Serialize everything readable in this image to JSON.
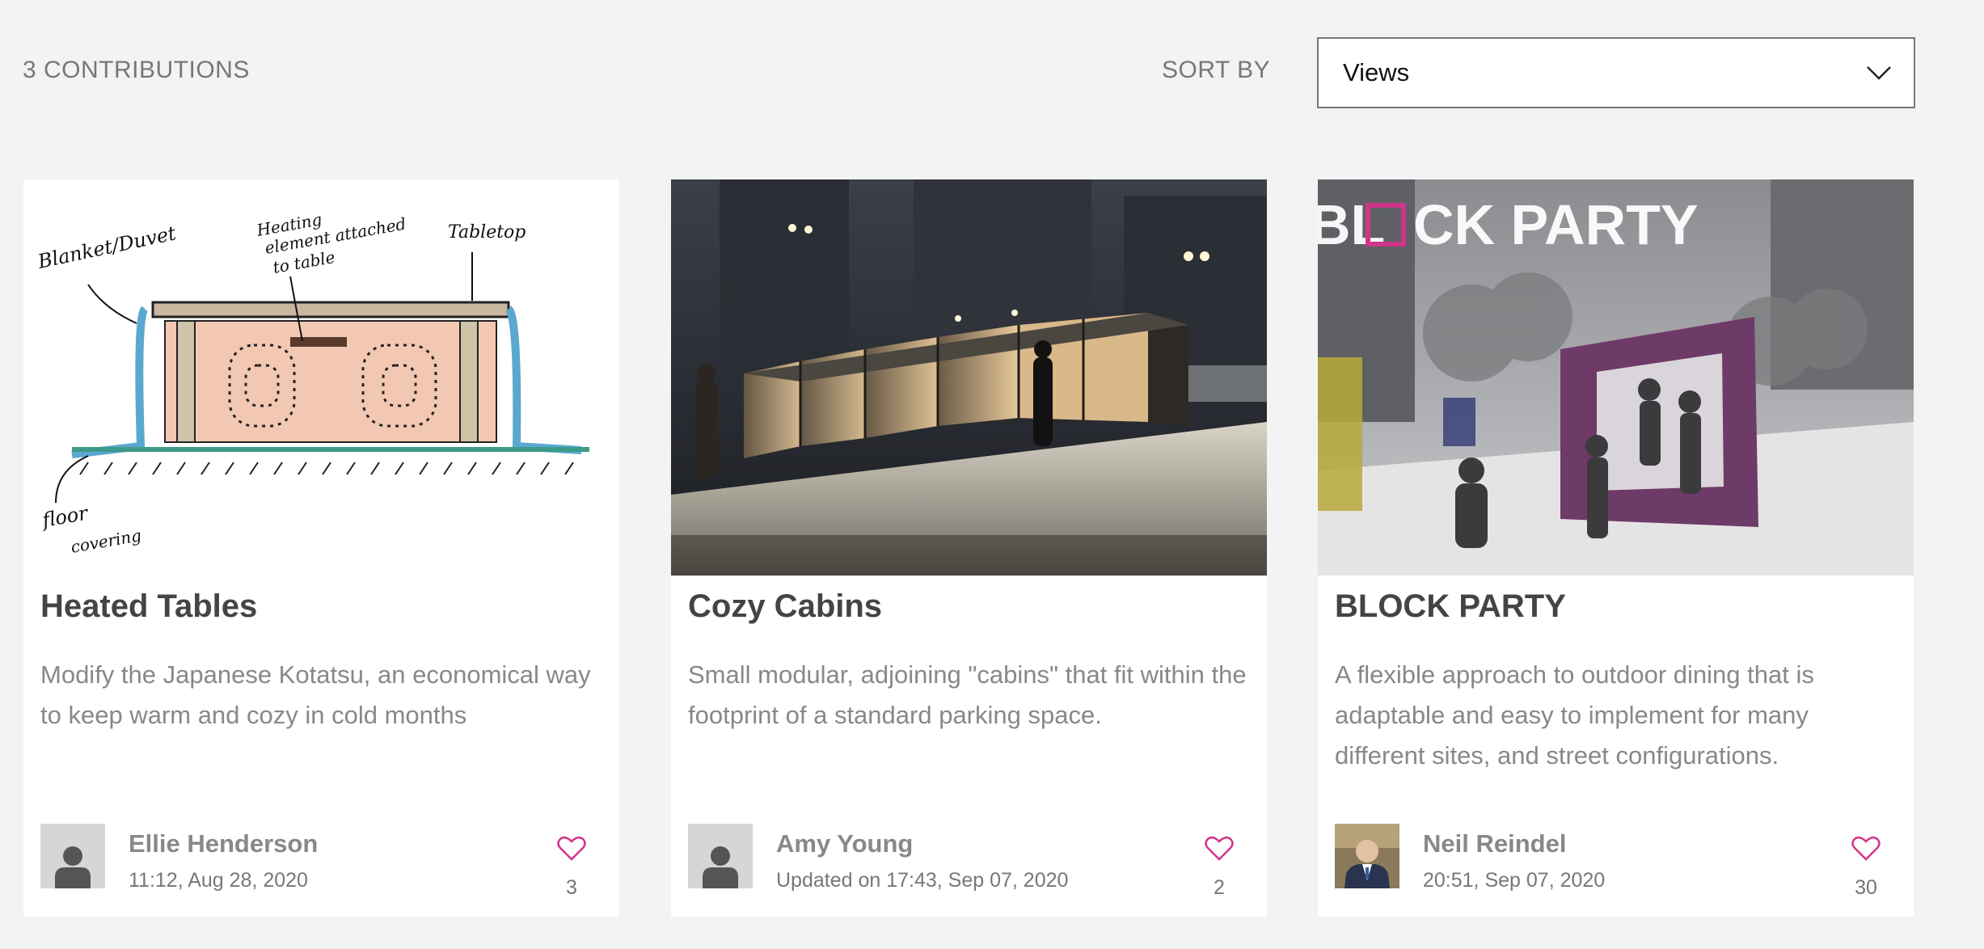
{
  "header": {
    "count_label": "3 CONTRIBUTIONS",
    "sort_label": "SORT BY",
    "sort_value": "Views"
  },
  "colors": {
    "background": "#f3f3f3",
    "accent_heart": "#d6338a",
    "title_text": "#444444",
    "muted_text": "#888888"
  },
  "cards": [
    {
      "title": "Heated Tables",
      "description": "Modify the Japanese Kotatsu, an economical way to keep warm and cozy in cold months",
      "author": "Ellie Henderson",
      "date": "11:12, Aug 28, 2020",
      "likes": "3",
      "image_labels": [
        "Blanket/Duvet",
        "Heating element attached to table",
        "Tabletop",
        "Floor covering"
      ],
      "avatar": "default-user-icon"
    },
    {
      "title": "Cozy Cabins",
      "description": "Small modular, adjoining \"cabins\" that fit within the footprint of a standard parking space.",
      "author": "Amy Young",
      "date": "Updated on 17:43, Sep 07, 2020",
      "likes": "2",
      "avatar": "default-user-icon"
    },
    {
      "title": "BLOCK PARTY",
      "description": "A flexible approach to outdoor dining that is adaptable and easy to implement for many different sites, and street configurations.",
      "author": "Neil Reindel",
      "date": "20:51, Sep 07, 2020",
      "likes": "30",
      "image_logo": "BL□CK PARTY",
      "avatar": "user-photo"
    }
  ]
}
